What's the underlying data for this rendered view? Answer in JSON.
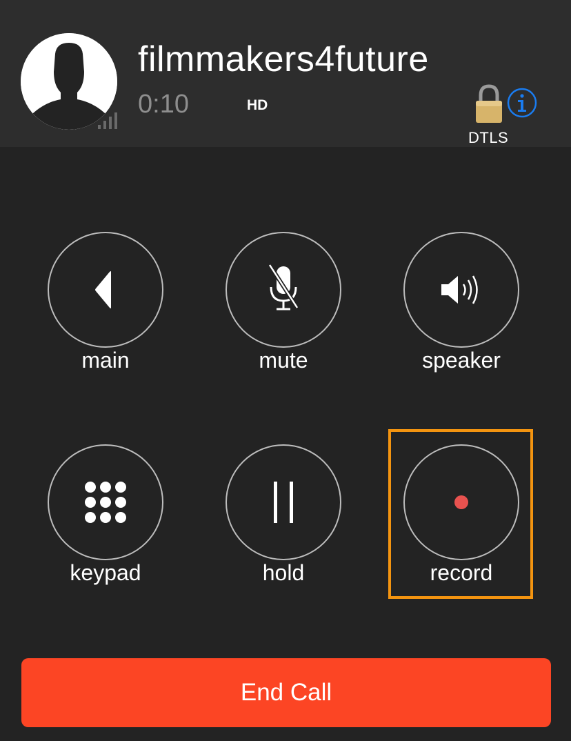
{
  "call": {
    "contact_name": "filmmakers4future",
    "duration": "0:10",
    "quality_badge": "HD",
    "security_label": "DTLS"
  },
  "icons": {
    "avatar": "person-silhouette-icon",
    "signal": "signal-strength-icon",
    "lock": "lock-icon",
    "info": "info-icon"
  },
  "controls": [
    {
      "id": "main",
      "label": "main",
      "icon": "back-triangle-icon"
    },
    {
      "id": "mute",
      "label": "mute",
      "icon": "mic-off-icon"
    },
    {
      "id": "speaker",
      "label": "speaker",
      "icon": "speaker-icon"
    },
    {
      "id": "keypad",
      "label": "keypad",
      "icon": "keypad-icon"
    },
    {
      "id": "hold",
      "label": "hold",
      "icon": "pause-icon"
    },
    {
      "id": "record",
      "label": "record",
      "icon": "record-dot-icon"
    }
  ],
  "end_call": {
    "label": "End Call"
  },
  "colors": {
    "background": "#232323",
    "header_background": "#2d2d2d",
    "end_call": "#fc4524",
    "record_dot": "#e8524f",
    "highlight": "#f39410",
    "info_blue": "#1a7cf0",
    "lock_gold": "#d7b46a"
  }
}
